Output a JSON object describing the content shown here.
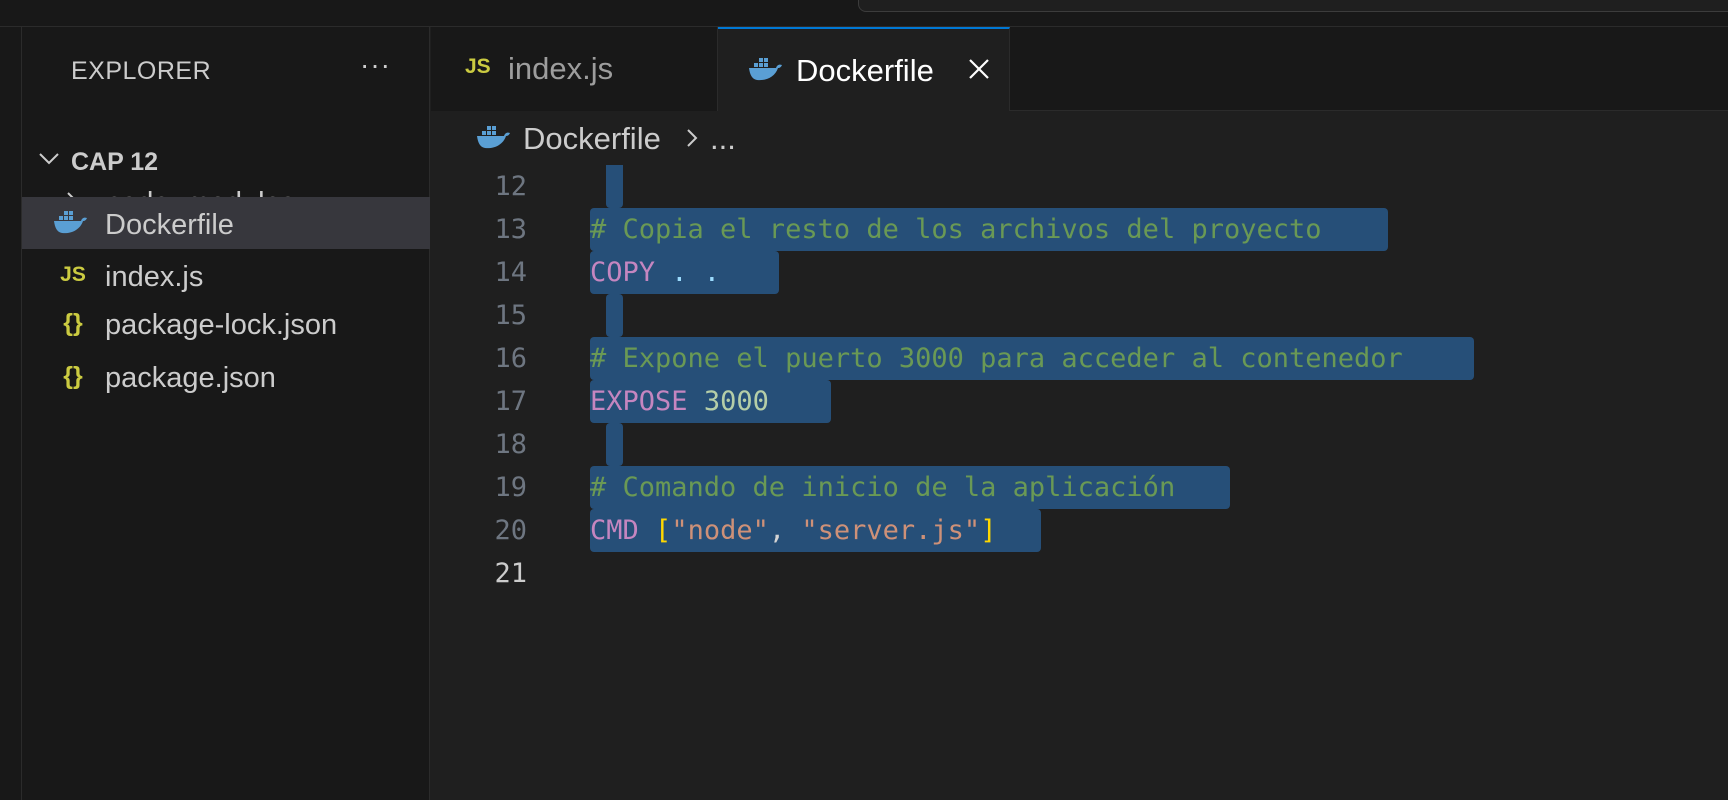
{
  "sidebar": {
    "title": "EXPLORER",
    "more_label": "···",
    "folder": "CAP 12",
    "items": [
      {
        "label": "node_modules",
        "icon": "chevron-right-icon"
      },
      {
        "label": "Dockerfile",
        "icon": "docker-icon"
      },
      {
        "label": "index.js",
        "icon": "js-icon",
        "glyph": "JS"
      },
      {
        "label": "package-lock.json",
        "icon": "json-icon",
        "glyph": "{}"
      },
      {
        "label": "package.json",
        "icon": "json-icon",
        "glyph": "{}"
      }
    ]
  },
  "tabs": [
    {
      "label": "index.js",
      "glyph": "JS",
      "active": false
    },
    {
      "label": "Dockerfile",
      "active": true
    }
  ],
  "breadcrumb": {
    "file": "Dockerfile",
    "more": "..."
  },
  "editor": {
    "lines": [
      {
        "n": "12"
      },
      {
        "n": "13"
      },
      {
        "n": "14"
      },
      {
        "n": "15"
      },
      {
        "n": "16"
      },
      {
        "n": "17"
      },
      {
        "n": "18"
      },
      {
        "n": "19"
      },
      {
        "n": "20"
      },
      {
        "n": "21"
      }
    ],
    "code": {
      "l13_comment": "# Copia el resto de los archivos del proyecto",
      "l14_kw": "COPY",
      "l14_args": " . .",
      "l16_comment": "# Expone el puerto 3000 para acceder al contenedor",
      "l17_kw": "EXPOSE",
      "l17_num": "3000",
      "l19_comment": "# Comando de inicio de la aplicación",
      "l20_kw": "CMD",
      "l20_open": "[",
      "l20_str1": "\"node\"",
      "l20_comma": ", ",
      "l20_str2": "\"server.js\"",
      "l20_close": "]"
    }
  },
  "colors": {
    "accent": "#0078d4",
    "selection": "#264f78",
    "comment": "#6a9955",
    "keyword": "#c586c0",
    "number": "#b5cea8",
    "string": "#ce9178"
  }
}
